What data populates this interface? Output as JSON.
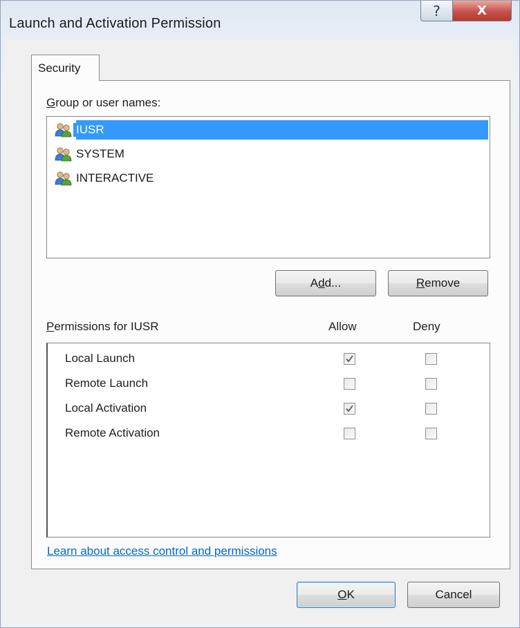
{
  "window": {
    "title": "Launch and Activation Permission",
    "help_glyph": "?",
    "close_glyph": "X"
  },
  "tabs": [
    {
      "label": "Security",
      "selected": true
    }
  ],
  "groups": {
    "label_prefix": "G",
    "label_rest": "roup or user names:",
    "items": [
      {
        "name": "IUSR",
        "icon": "users-icon",
        "selected": true
      },
      {
        "name": "SYSTEM",
        "icon": "users-icon",
        "selected": false
      },
      {
        "name": "INTERACTIVE",
        "icon": "users-icon",
        "selected": false
      }
    ]
  },
  "buttons": {
    "add_a": "A",
    "add_d": "d",
    "add_rest": "d...",
    "remove_r": "R",
    "remove_rest": "emove",
    "ok_o": "O",
    "ok_rest": "K",
    "cancel": "Cancel"
  },
  "permissions": {
    "label_prefix": "P",
    "label_rest": "ermissions for IUSR",
    "allow_header": "Allow",
    "deny_header": "Deny",
    "rows": [
      {
        "name": "Local Launch",
        "allow": true,
        "deny": false
      },
      {
        "name": "Remote Launch",
        "allow": false,
        "deny": false
      },
      {
        "name": "Local Activation",
        "allow": true,
        "deny": false
      },
      {
        "name": "Remote Activation",
        "allow": false,
        "deny": false
      }
    ]
  },
  "link": {
    "text": "Learn about access control and permissions"
  },
  "colors": {
    "selection": "#3399ff",
    "link": "#0066cc"
  }
}
